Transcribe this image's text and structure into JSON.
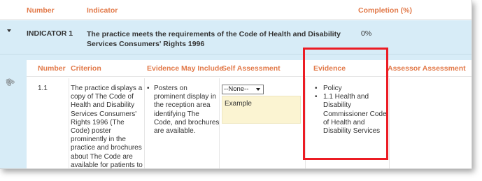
{
  "header": {
    "number_label": "Number",
    "indicator_label": "Indicator",
    "completion_label": "Completion (%)"
  },
  "indicator": {
    "number": "INDICATOR 1",
    "text": "The practice meets the requirements of the Code of Health and Disability Services Consumers' Rights 1996",
    "completion": "0%"
  },
  "subheader": {
    "number": "Number",
    "criterion": "Criterion",
    "evidence_may_include": "Evidence May Include",
    "self_assessment": "Self Assessment",
    "evidence": "Evidence",
    "assessor_assessment": "Assessor Assessment"
  },
  "rows": [
    {
      "number": "1.1",
      "criterion": "The practice displays a copy of The Code of Health and Disability Services Consumers' Rights 1996 (The Code) poster prominently in the practice and brochures about The Code are available for patients to access.",
      "evidence_may_include": "Posters on prominent display in the reception area identifying The Code, and brochures are available.",
      "self_assessment_select": "--None--",
      "self_assessment_text": "Example",
      "evidence": [
        "Policy",
        "1.1 Health and Disability Commissioner Code of Health and Disability Services"
      ]
    }
  ],
  "icons": {
    "collapse": "chevron-down-icon",
    "attachment": "paperclip-icon"
  },
  "colors": {
    "header_text": "#e27a4a",
    "indicator_bg": "#d7ecf7",
    "self_assessment_bg": "#fbf4d2",
    "highlight": "#ec1c24"
  }
}
